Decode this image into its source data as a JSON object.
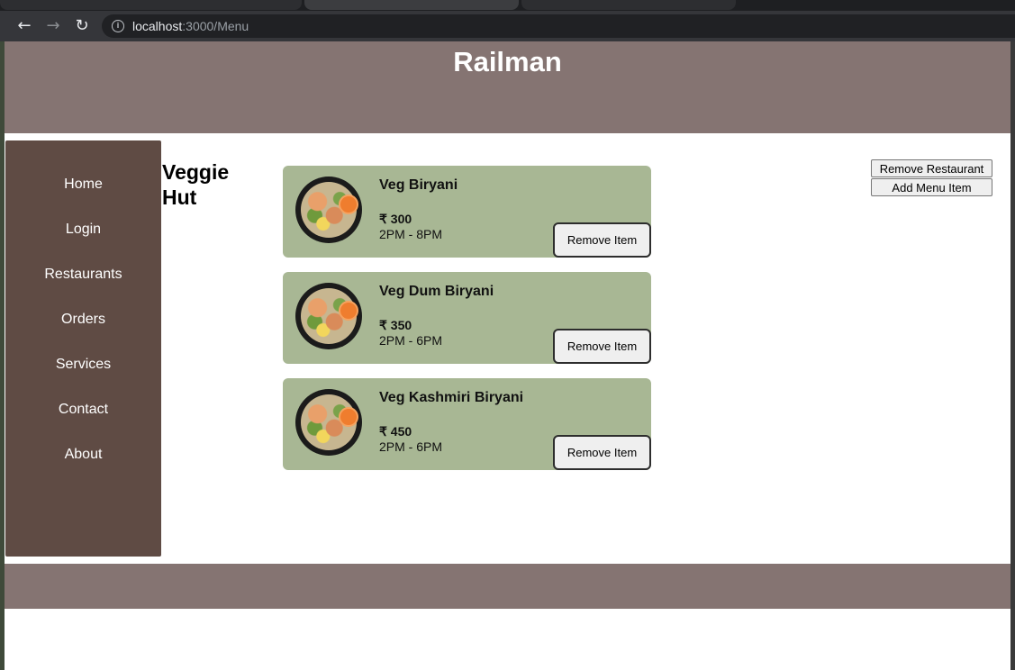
{
  "browser": {
    "url_host": "localhost",
    "url_path": ":3000/Menu"
  },
  "header": {
    "title": "Railman"
  },
  "sidebar": {
    "items": [
      {
        "label": "Home"
      },
      {
        "label": "Login"
      },
      {
        "label": "Restaurants"
      },
      {
        "label": "Orders"
      },
      {
        "label": "Services"
      },
      {
        "label": "Contact"
      },
      {
        "label": "About"
      }
    ]
  },
  "restaurant": {
    "name": "Veggie Hut"
  },
  "actions": {
    "remove_restaurant": "Remove Restaurant",
    "add_menu_item": "Add Menu Item"
  },
  "menu": {
    "items": [
      {
        "name": "Veg Biryani",
        "price": "₹ 300",
        "time": "2PM - 8PM",
        "remove_label": "Remove Item"
      },
      {
        "name": "Veg Dum Biryani",
        "price": "₹ 350",
        "time": "2PM - 6PM",
        "remove_label": "Remove Item"
      },
      {
        "name": "Veg Kashmiri Biryani",
        "price": "₹ 450",
        "time": "2PM - 6PM",
        "remove_label": "Remove Item"
      }
    ]
  },
  "colors": {
    "header": "#857472",
    "sidebar": "#5f4b44",
    "card": "#a8b794"
  }
}
